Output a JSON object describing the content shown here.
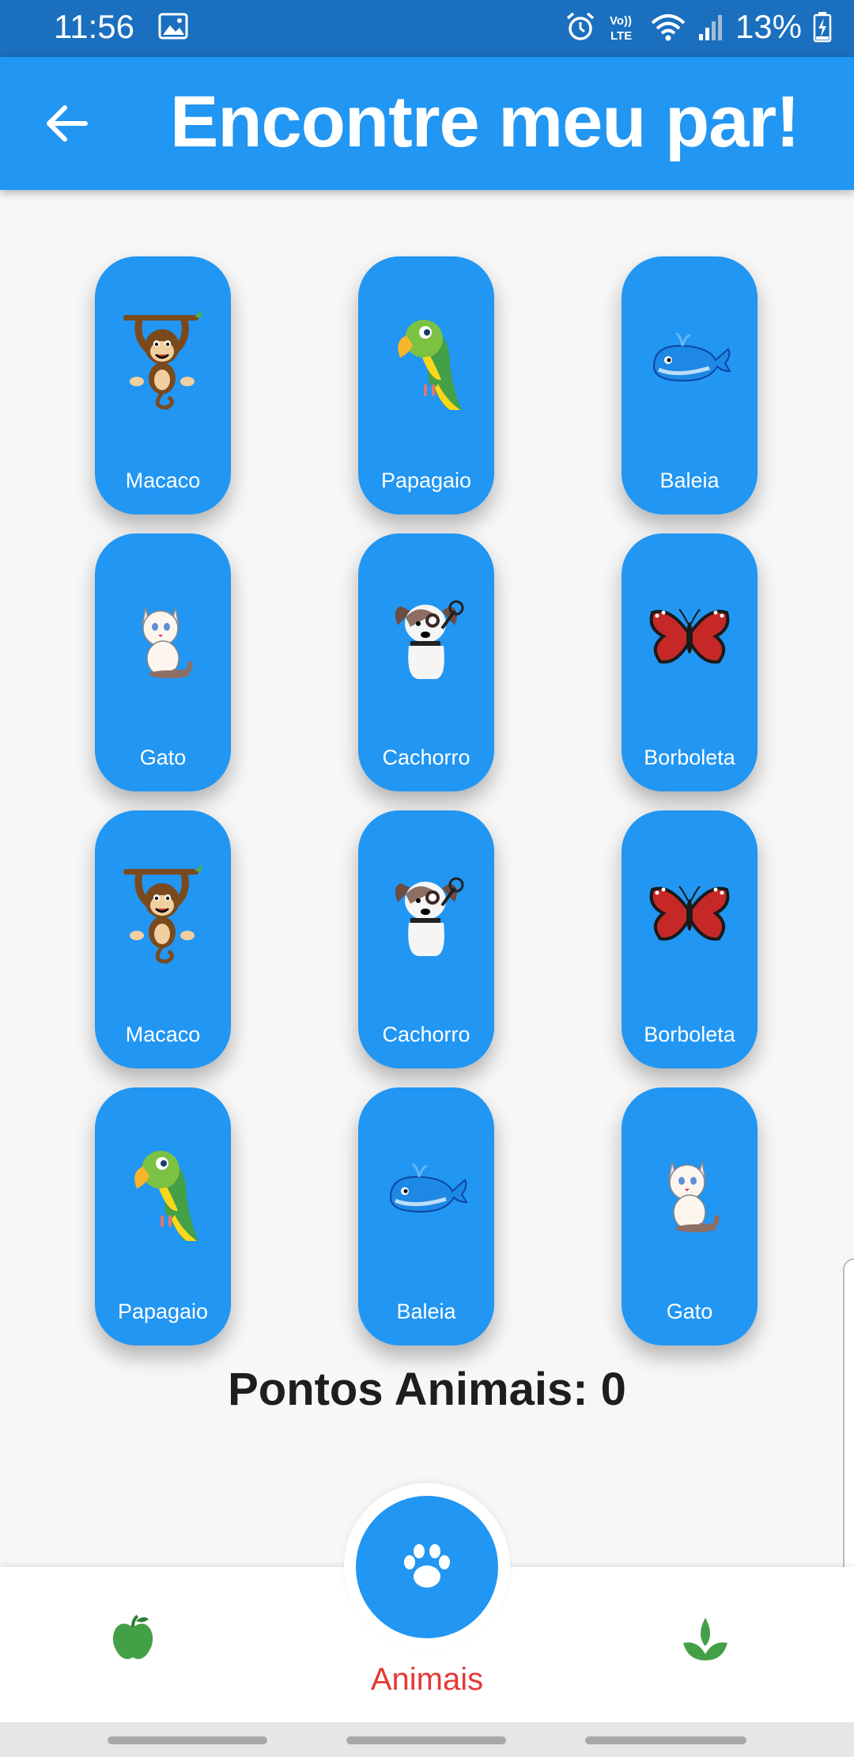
{
  "status_bar": {
    "time": "11:56",
    "battery": "13%",
    "icons": [
      "image-icon",
      "alarm-icon",
      "volte-icon",
      "wifi-icon",
      "signal-icon",
      "battery-icon"
    ]
  },
  "app_bar": {
    "title": "Encontre meu par!",
    "back_icon": "arrow-back-icon",
    "color": "#2196f3"
  },
  "cards": [
    {
      "label": "Macaco",
      "icon": "monkey"
    },
    {
      "label": "Papagaio",
      "icon": "parrot"
    },
    {
      "label": "Baleia",
      "icon": "whale"
    },
    {
      "label": "Gato",
      "icon": "cat"
    },
    {
      "label": "Cachorro",
      "icon": "dog"
    },
    {
      "label": "Borboleta",
      "icon": "butterfly"
    },
    {
      "label": "Macaco",
      "icon": "monkey"
    },
    {
      "label": "Cachorro",
      "icon": "dog"
    },
    {
      "label": "Borboleta",
      "icon": "butterfly"
    },
    {
      "label": "Papagaio",
      "icon": "parrot"
    },
    {
      "label": "Baleia",
      "icon": "whale"
    },
    {
      "label": "Gato",
      "icon": "cat"
    }
  ],
  "score": {
    "text": "Pontos Animais: 0"
  },
  "bottom_nav": {
    "items": [
      {
        "icon": "apple-icon"
      },
      {
        "icon": "paw-icon",
        "label": "Animais",
        "active": true
      },
      {
        "icon": "plant-icon"
      }
    ],
    "active_label_color": "#e53935",
    "fab_color": "#2196f3"
  }
}
